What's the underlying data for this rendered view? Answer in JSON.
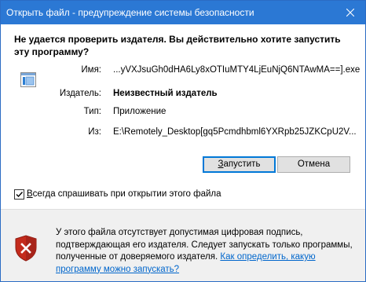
{
  "window": {
    "title": "Открыть файл - предупреждение системы безопасности"
  },
  "dialog": {
    "heading": "Не удается проверить издателя.  Вы действительно хотите запустить эту программу?",
    "fields": {
      "name_label": "Имя:",
      "name_value": "...yVXJsuGh0dHA6Ly8xOTIuMTY4LjEuNjQ6NTAwMA==].exe",
      "publisher_label": "Издатель:",
      "publisher_value": "Неизвестный издатель",
      "type_label": "Тип:",
      "type_value": "Приложение",
      "from_label": "Из:",
      "from_value": "E:\\Remotely_Desktop[gq5Pcmdhbml6YXRpb25JZKCpU2V..."
    },
    "buttons": {
      "run_label_underlined": "З",
      "run_label_rest": "апустить",
      "cancel_label": "Отмена"
    },
    "checkbox": {
      "label_underlined": "В",
      "label_rest": "сегда спрашивать при открытии этого файла",
      "checked": true
    }
  },
  "footer": {
    "warning_text": "У этого файла отсутствует допустимая цифровая подпись, подтверждающая его издателя.  Следует запускать только программы, полученные от доверяемого издателя. ",
    "link_text": "Как определить, какую программу можно запускать?"
  },
  "colors": {
    "titlebar": "#2b78d4",
    "link": "#0066cc",
    "footer_bg": "#f0f0f0",
    "shield_red": "#c42b1c"
  }
}
